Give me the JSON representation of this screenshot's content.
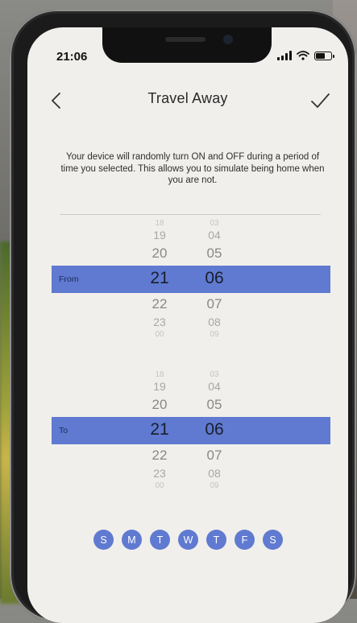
{
  "status_bar": {
    "time": "21:06"
  },
  "nav": {
    "title": "Travel Away",
    "back_icon": "chevron-left-icon",
    "confirm_icon": "checkmark-icon"
  },
  "description": "Your device will randomly turn ON and OFF during a period of time you selected. This allows you to simulate being home when you are not.",
  "from_picker": {
    "label": "From",
    "hours_above": [
      "18",
      "19",
      "20"
    ],
    "minutes_above": [
      "03",
      "04",
      "05"
    ],
    "selected_hour": "21",
    "selected_minute": "06",
    "hours_below": [
      "22",
      "23",
      "00"
    ],
    "minutes_below": [
      "07",
      "08",
      "09"
    ]
  },
  "to_picker": {
    "label": "To",
    "hours_above": [
      "18",
      "19",
      "20"
    ],
    "minutes_above": [
      "03",
      "04",
      "05"
    ],
    "selected_hour": "21",
    "selected_minute": "06",
    "hours_below": [
      "22",
      "23",
      "00"
    ],
    "minutes_below": [
      "07",
      "08",
      "09"
    ]
  },
  "days": [
    "S",
    "M",
    "T",
    "W",
    "T",
    "F",
    "S"
  ],
  "colors": {
    "accent": "#5f7ad0",
    "background": "#f1efec"
  }
}
